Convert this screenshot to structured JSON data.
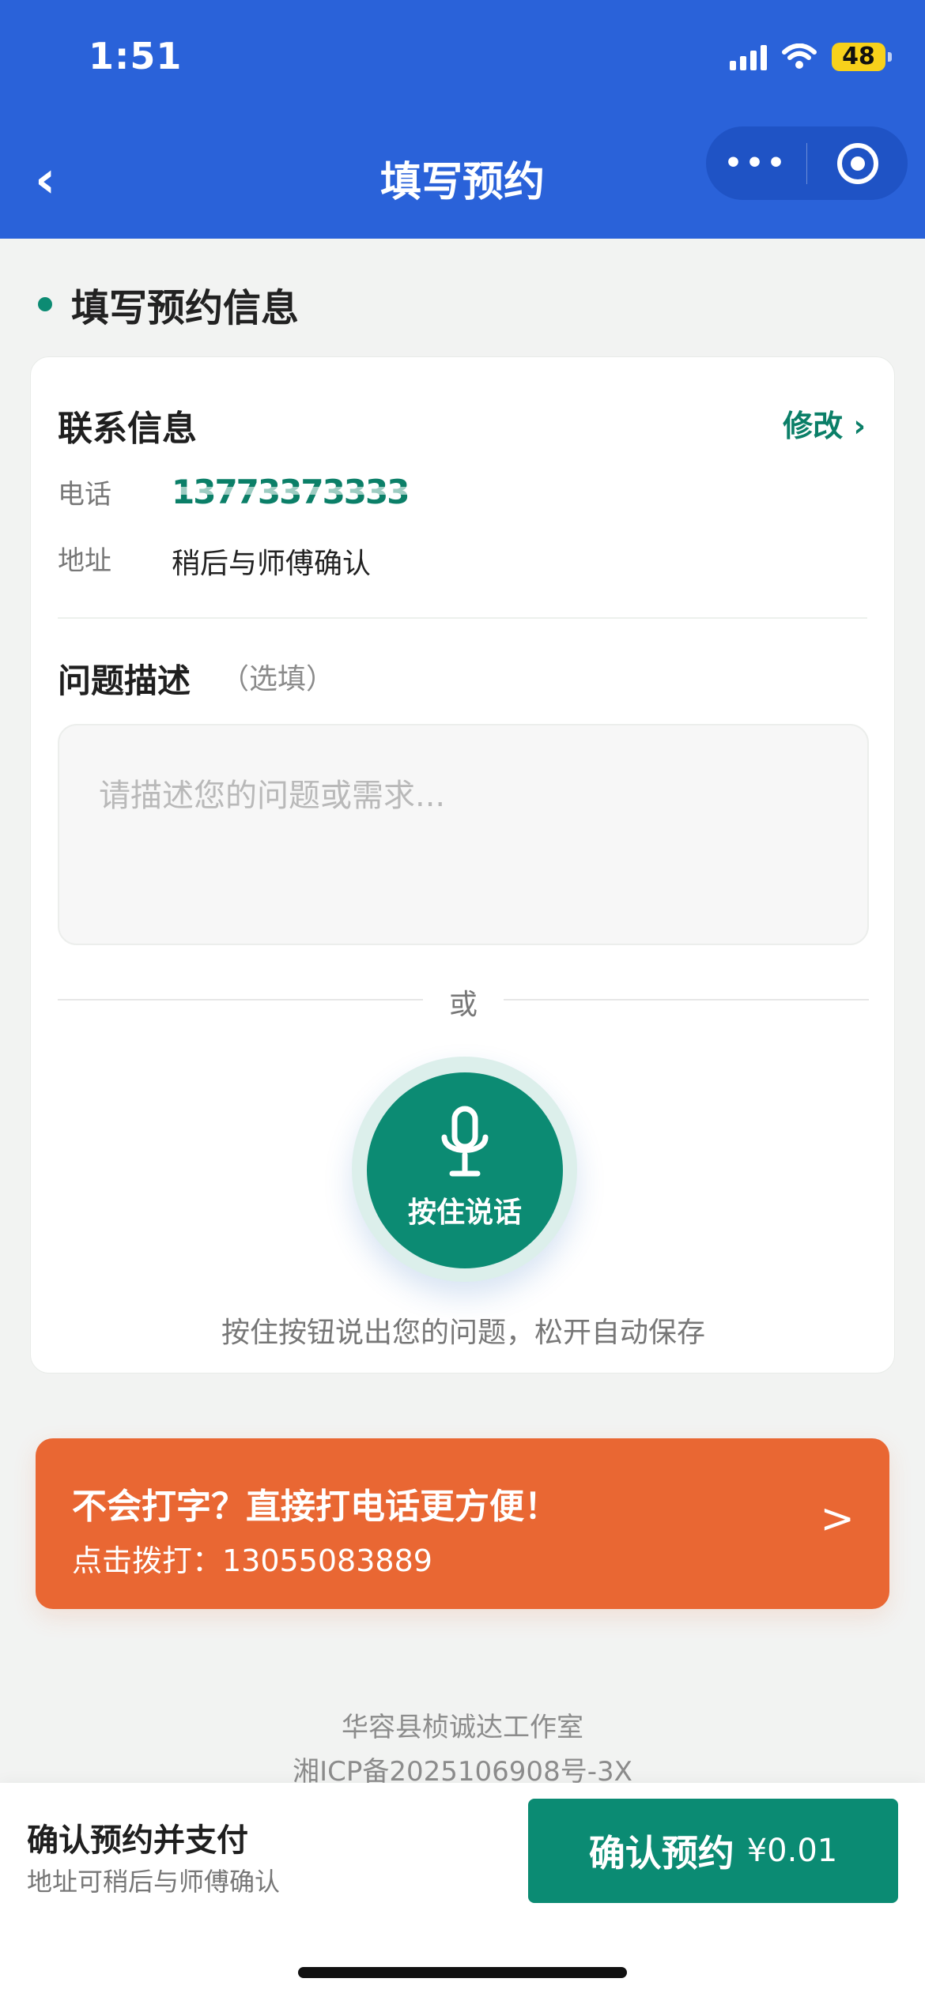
{
  "status": {
    "time": "1:51",
    "battery": "48"
  },
  "nav": {
    "title": "填写预约",
    "back_icon": "chevron-left-icon",
    "more_icon": "more-dots-icon",
    "close_icon": "target-icon"
  },
  "section": {
    "title": "填写预约信息"
  },
  "contact": {
    "title": "联系信息",
    "edit": "修改 ›",
    "phone_label": "电话",
    "phone_value": "13773373333",
    "address_label": "地址",
    "address_value": "稍后与师傅确认"
  },
  "problem": {
    "title": "问题描述",
    "optional": "（选填）",
    "placeholder": "请描述您的问题或需求..."
  },
  "voice": {
    "or": "或",
    "button_label": "按住说话",
    "hint": "按住按钮说出您的问题，松开自动保存",
    "icon": "microphone-icon"
  },
  "call": {
    "title": "不会打字？直接打电话更方便！",
    "subtitle": "点击拨打：13055083889",
    "arrow": ">"
  },
  "footer": {
    "company": "华容县桢诚达工作室",
    "icp": "湘ICP备2025106908号-3X"
  },
  "bottom": {
    "title": "确认预约并支付",
    "subtitle": "地址可稍后与师傅确认",
    "button": "确认预约",
    "price": "¥0.01"
  }
}
